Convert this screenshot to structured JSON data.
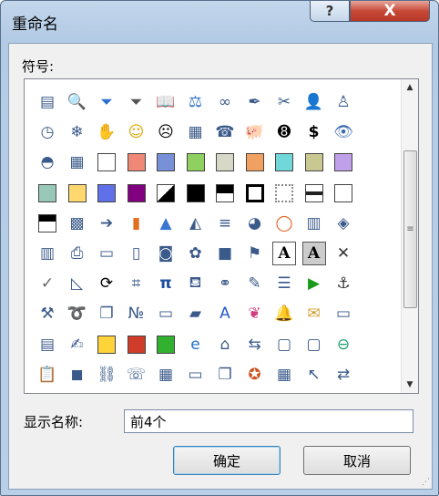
{
  "window": {
    "title": "重命名",
    "help_glyph": "?",
    "close_glyph": "X"
  },
  "symbols_label": "符号:",
  "symbol_grid": {
    "icons": [
      [
        "window",
        "magnifier",
        "filter-blue",
        "filter-gray",
        "book",
        "scales",
        "rings",
        "pen-nib",
        "wrench-cross",
        "person",
        "chess-pieces"
      ],
      [
        "clock",
        "snowflake",
        "hand",
        "smiley",
        "sad-face",
        "calculator",
        "phone",
        "piggy-bank",
        "eight-ball",
        "dollar",
        "eye"
      ],
      [
        "saucer",
        "color-grid",
        "#ffffff",
        "#f08878",
        "#7890d8",
        "#90d060",
        "#d8d8c8",
        "#f0a060",
        "#70d8d8",
        "#c8c890",
        "#c0a0e8"
      ],
      [
        "#98c8b8",
        "#ffd870",
        "#6070e8",
        "#800080",
        "diag",
        "#000000",
        "half-black",
        "border-black",
        "dotted",
        "half-gray",
        "#ffffff"
      ],
      [
        "top-black",
        "checker",
        "arrow-circle",
        "bar-chart",
        "cone",
        "area-chart",
        "stacked-bar",
        "pie",
        "donut",
        "cylinders",
        "book-stack"
      ],
      [
        "books",
        "printer",
        "landscape",
        "doc-flat",
        "portrait",
        "reel",
        "diag-bw",
        "flags",
        "A-box",
        "A-dark",
        "cross-x"
      ],
      [
        "check",
        "ruler",
        "refresh",
        "matrix",
        "pi",
        "paint-bucket",
        "binoculars",
        "brush",
        "list",
        "play",
        "anchor"
      ],
      [
        "worker",
        "lasso",
        "copy",
        "numbers",
        "folder",
        "eraser",
        "A-blue",
        "butterfly",
        "bell",
        "mail",
        "card"
      ],
      [
        "form",
        "edit-pen",
        "#ffd43a",
        "#d03c2a",
        "#32b030",
        "ie",
        "home",
        "sign",
        "frame",
        "note",
        "no-entry"
      ],
      [
        "clipboard",
        "cube",
        "chain",
        "fax",
        "table",
        "window-frame",
        "windows",
        "medal",
        "grid-doc",
        "cursor",
        "sign2"
      ]
    ],
    "scrollbar": {
      "up": "▲",
      "down": "▼",
      "grip": "≡"
    }
  },
  "display_name_label": "显示名称:",
  "display_name_value": "前4个",
  "buttons": {
    "ok": "确定",
    "cancel": "取消"
  },
  "size_grip": "⋰"
}
